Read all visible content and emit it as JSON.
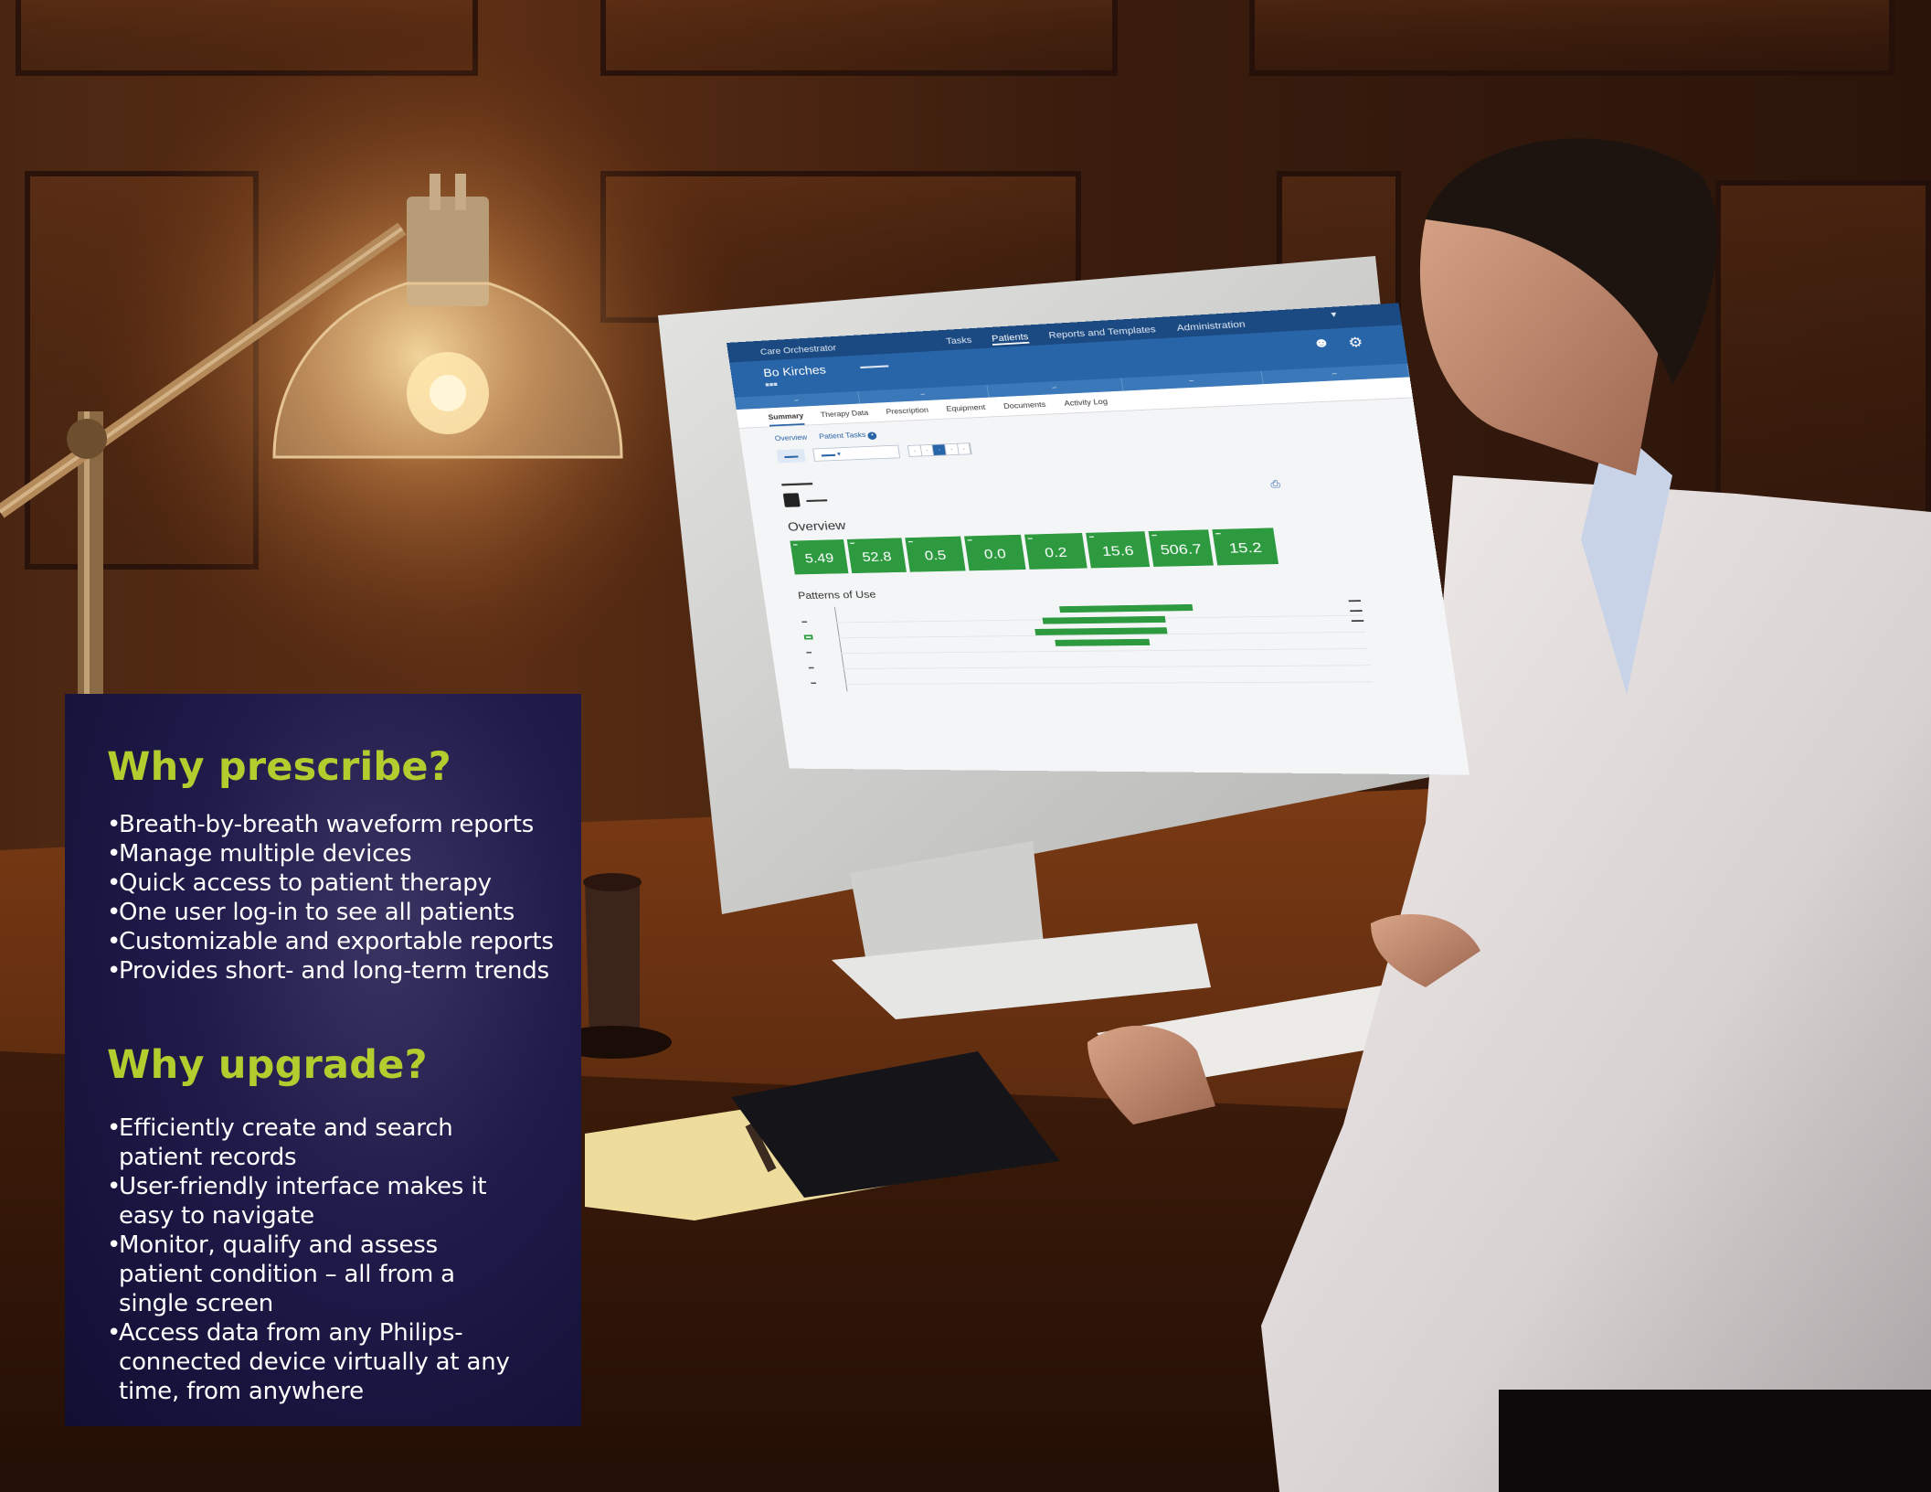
{
  "panel": {
    "prescribe": {
      "heading": "Why prescribe?",
      "items": [
        "Breath-by-breath waveform reports",
        "Manage multiple devices",
        "Quick access to patient therapy",
        "One user log-in to see all patients",
        "Customizable and exportable reports",
        "Provides short- and long-term trends"
      ]
    },
    "upgrade": {
      "heading": "Why upgrade?",
      "items": [
        "Efficiently create and search patient records",
        "User-friendly interface makes it easy to navigate",
        "Monitor, qualify and assess patient condition – all from a single screen",
        "Access data from any Philips-connected device virtually at any time, from anywhere"
      ]
    }
  },
  "screen": {
    "app_title": "Care Orchestrator",
    "menu": [
      "Tasks",
      "Patients",
      "Reports and Templates",
      "Administration"
    ],
    "patient_name": "Bo Kirches",
    "tabs": [
      "Summary",
      "Therapy Data",
      "Prescription",
      "Equipment",
      "Documents",
      "Activity Log"
    ],
    "subtabs": [
      "Overview",
      "Patient Tasks"
    ],
    "overview_title": "Overview",
    "overview_values": [
      "5.49",
      "52.8",
      "0.5",
      "0.0",
      "0.2",
      "15.6",
      "506.7",
      "15.2"
    ],
    "patterns_title": "Patterns of Use"
  },
  "colors": {
    "panel_bg": "#1a1640",
    "heading": "#b3cc2e",
    "body_text": "#ffffff",
    "ui_header": "#1b4a82",
    "ui_tile": "#2e9a40"
  }
}
